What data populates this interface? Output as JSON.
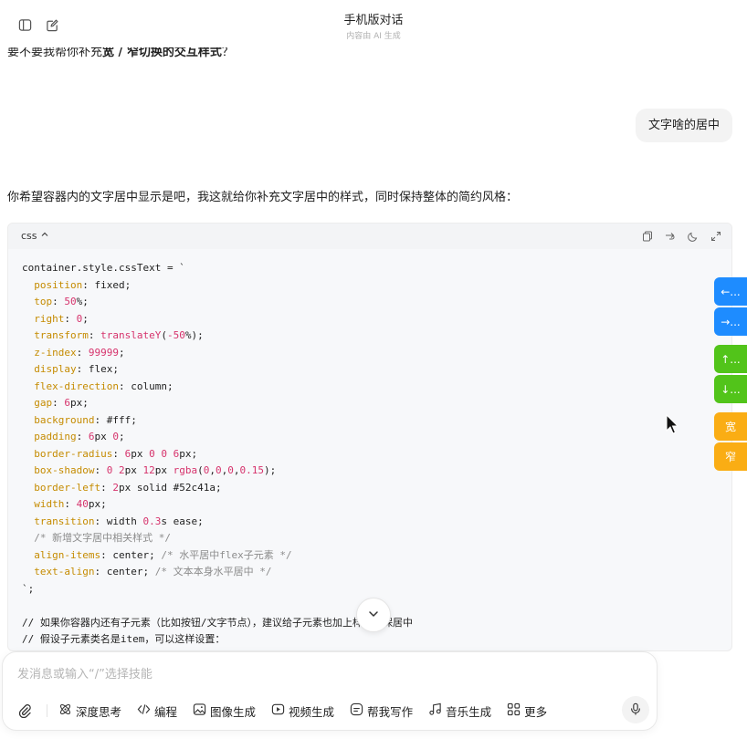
{
  "header": {
    "title": "手机版对话",
    "subtitle": "内容由 AI 生成"
  },
  "messages": {
    "prev_ai_prefix": "要不要我帮你补充",
    "prev_ai_bold": "宽 / 窄切换的交互样式",
    "prev_ai_suffix": "？",
    "user_text": "文字啥的居中",
    "ai_text": "你希望容器内的文字居中显示是吧，我这就给你补充文字居中的样式，同时保持整体的简约风格："
  },
  "code_block": {
    "language": "css",
    "lines": [
      [
        [
          "t",
          "container.style.cssText = `"
        ]
      ],
      [
        [
          "t",
          "  "
        ],
        [
          "p",
          "position"
        ],
        [
          "t",
          ": fixed;"
        ]
      ],
      [
        [
          "t",
          "  "
        ],
        [
          "p",
          "top"
        ],
        [
          "t",
          ": "
        ],
        [
          "n",
          "50"
        ],
        [
          "t",
          "%;"
        ]
      ],
      [
        [
          "t",
          "  "
        ],
        [
          "p",
          "right"
        ],
        [
          "t",
          ": "
        ],
        [
          "n",
          "0"
        ],
        [
          "t",
          ";"
        ]
      ],
      [
        [
          "t",
          "  "
        ],
        [
          "p",
          "transform"
        ],
        [
          "t",
          ": "
        ],
        [
          "f",
          "translateY"
        ],
        [
          "t",
          "("
        ],
        [
          "n",
          "-50"
        ],
        [
          "t",
          "%);"
        ]
      ],
      [
        [
          "t",
          "  "
        ],
        [
          "p",
          "z-index"
        ],
        [
          "t",
          ": "
        ],
        [
          "n",
          "99999"
        ],
        [
          "t",
          ";"
        ]
      ],
      [
        [
          "t",
          "  "
        ],
        [
          "p",
          "display"
        ],
        [
          "t",
          ": flex;"
        ]
      ],
      [
        [
          "t",
          "  "
        ],
        [
          "p",
          "flex-direction"
        ],
        [
          "t",
          ": column;"
        ]
      ],
      [
        [
          "t",
          "  "
        ],
        [
          "p",
          "gap"
        ],
        [
          "t",
          ": "
        ],
        [
          "n",
          "6"
        ],
        [
          "t",
          "px;"
        ]
      ],
      [
        [
          "t",
          "  "
        ],
        [
          "p",
          "background"
        ],
        [
          "t",
          ": #fff;"
        ]
      ],
      [
        [
          "t",
          "  "
        ],
        [
          "p",
          "padding"
        ],
        [
          "t",
          ": "
        ],
        [
          "n",
          "6"
        ],
        [
          "t",
          "px "
        ],
        [
          "n",
          "0"
        ],
        [
          "t",
          ";"
        ]
      ],
      [
        [
          "t",
          "  "
        ],
        [
          "p",
          "border-radius"
        ],
        [
          "t",
          ": "
        ],
        [
          "n",
          "6"
        ],
        [
          "t",
          "px "
        ],
        [
          "n",
          "0"
        ],
        [
          "t",
          " "
        ],
        [
          "n",
          "0"
        ],
        [
          "t",
          " "
        ],
        [
          "n",
          "6"
        ],
        [
          "t",
          "px;"
        ]
      ],
      [
        [
          "t",
          "  "
        ],
        [
          "p",
          "box-shadow"
        ],
        [
          "t",
          ": "
        ],
        [
          "n",
          "0"
        ],
        [
          "t",
          " "
        ],
        [
          "n",
          "2"
        ],
        [
          "t",
          "px "
        ],
        [
          "n",
          "12"
        ],
        [
          "t",
          "px "
        ],
        [
          "f",
          "rgba"
        ],
        [
          "t",
          "("
        ],
        [
          "n",
          "0"
        ],
        [
          "t",
          ","
        ],
        [
          "n",
          "0"
        ],
        [
          "t",
          ","
        ],
        [
          "n",
          "0"
        ],
        [
          "t",
          ","
        ],
        [
          "n",
          "0.15"
        ],
        [
          "t",
          ");"
        ]
      ],
      [
        [
          "t",
          "  "
        ],
        [
          "p",
          "border-left"
        ],
        [
          "t",
          ": "
        ],
        [
          "n",
          "2"
        ],
        [
          "t",
          "px solid #52c41a;"
        ]
      ],
      [
        [
          "t",
          "  "
        ],
        [
          "p",
          "width"
        ],
        [
          "t",
          ": "
        ],
        [
          "n",
          "40"
        ],
        [
          "t",
          "px;"
        ]
      ],
      [
        [
          "t",
          "  "
        ],
        [
          "p",
          "transition"
        ],
        [
          "t",
          ": width "
        ],
        [
          "n",
          "0.3"
        ],
        [
          "t",
          "s ease;"
        ]
      ],
      [
        [
          "t",
          "  "
        ],
        [
          "c",
          "/* 新增文字居中相关样式 */"
        ]
      ],
      [
        [
          "t",
          "  "
        ],
        [
          "p",
          "align-items"
        ],
        [
          "t",
          ": center; "
        ],
        [
          "c",
          "/* 水平居中flex子元素 */"
        ]
      ],
      [
        [
          "t",
          "  "
        ],
        [
          "p",
          "text-align"
        ],
        [
          "t",
          ": center; "
        ],
        [
          "c",
          "/* 文本本身水平居中 */"
        ]
      ],
      [
        [
          "t",
          "`;"
        ]
      ],
      [
        [
          "t",
          ""
        ]
      ],
      [
        [
          "t",
          "// 如果你容器内还有子元素（比如按钮/文字节点），建议给子元素也加上样式确保居中"
        ]
      ],
      [
        [
          "t",
          "// 假设子元素类名是item，可以这样设置："
        ]
      ]
    ]
  },
  "side_buttons": [
    "←...",
    "→...",
    "↑...",
    "↓...",
    "宽",
    "窄"
  ],
  "side_colors": {
    "blue": "#1e8cff",
    "green": "#52c41a",
    "orange": "#faad14"
  },
  "input": {
    "placeholder": "发消息或输入“/”选择技能",
    "value": ""
  },
  "toolbar": {
    "items": [
      {
        "icon": "atom-icon",
        "label": "深度思考"
      },
      {
        "icon": "code-icon",
        "label": "编程"
      },
      {
        "icon": "image-icon",
        "label": "图像生成"
      },
      {
        "icon": "video-play-icon",
        "label": "视频生成"
      },
      {
        "icon": "pen-note-icon",
        "label": "帮我写作"
      },
      {
        "icon": "music-note-icon",
        "label": "音乐生成"
      },
      {
        "icon": "grid-icon",
        "label": "更多"
      }
    ]
  }
}
